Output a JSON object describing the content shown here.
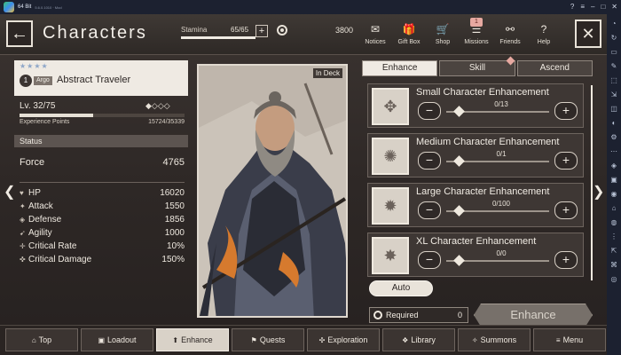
{
  "emulator": {
    "app_name": "64 Bit",
    "app_sub": "5.6.0.1010 · Mod",
    "side_icons": [
      "◔",
      "↻",
      "▭",
      "✎",
      "⬚",
      "⇲",
      "◫",
      "◐",
      "⚙",
      "⋯",
      "◈",
      "▣",
      "◉",
      "⌂",
      "◍",
      "⋮",
      "⇱",
      "⌘",
      "◎"
    ]
  },
  "header": {
    "title": "Characters",
    "stamina_label": "Stamina",
    "stamina_value": "65/65",
    "stamina_fill": 1.0,
    "currency": "3800",
    "nav": [
      {
        "label": "Notices",
        "icon": "✉"
      },
      {
        "label": "Gift Box",
        "icon": "🎁"
      },
      {
        "label": "Shop",
        "icon": "🛒"
      },
      {
        "label": "Missions",
        "icon": "☰",
        "badge": "1"
      },
      {
        "label": "Friends",
        "icon": "⚯"
      },
      {
        "label": "Help",
        "icon": "?"
      }
    ]
  },
  "character": {
    "stars": "★★★★",
    "rank": "1",
    "alias": "Argo",
    "name": "Abstract Traveler",
    "level": "Lv. 32/75",
    "diamonds": "◆◇◇◇",
    "xp_label": "Experience Points",
    "xp_value": "15724/35339",
    "xp_fill": 0.445,
    "status_title": "Status",
    "force_label": "Force",
    "force_value": "4765",
    "stats": [
      {
        "icon": "♥",
        "label": "HP",
        "value": "16020"
      },
      {
        "icon": "✦",
        "label": "Attack",
        "value": "1550"
      },
      {
        "icon": "◈",
        "label": "Defense",
        "value": "1856"
      },
      {
        "icon": "➹",
        "label": "Agility",
        "value": "1000"
      },
      {
        "icon": "✛",
        "label": "Critical Rate",
        "value": "10%"
      },
      {
        "icon": "✜",
        "label": "Critical Damage",
        "value": "150%"
      }
    ],
    "in_deck": "In Deck"
  },
  "tabs": [
    {
      "label": "Enhance",
      "active": true
    },
    {
      "label": "Skill",
      "active": false
    },
    {
      "label": "Ascend",
      "active": false
    }
  ],
  "enhancements": [
    {
      "name": "Small Character Enhancement",
      "count": "0/13"
    },
    {
      "name": "Medium Character Enhancement",
      "count": "0/1"
    },
    {
      "name": "Large Character Enhancement",
      "count": "0/100"
    },
    {
      "name": "XL Character Enhancement",
      "count": "0/0"
    }
  ],
  "auto_label": "Auto",
  "required_label": "Required",
  "required_value": "0",
  "enhance_button": "Enhance",
  "bottom_nav": [
    {
      "label": "Top",
      "icon": "⌂",
      "active": false
    },
    {
      "label": "Loadout",
      "icon": "▣",
      "active": false
    },
    {
      "label": "Enhance",
      "icon": "⬆",
      "active": true
    },
    {
      "label": "Quests",
      "icon": "⚑",
      "active": false
    },
    {
      "label": "Exploration",
      "icon": "✣",
      "active": false
    },
    {
      "label": "Library",
      "icon": "❖",
      "active": false
    },
    {
      "label": "Summons",
      "icon": "✧",
      "active": false
    },
    {
      "label": "Menu",
      "icon": "≡",
      "active": false
    }
  ]
}
